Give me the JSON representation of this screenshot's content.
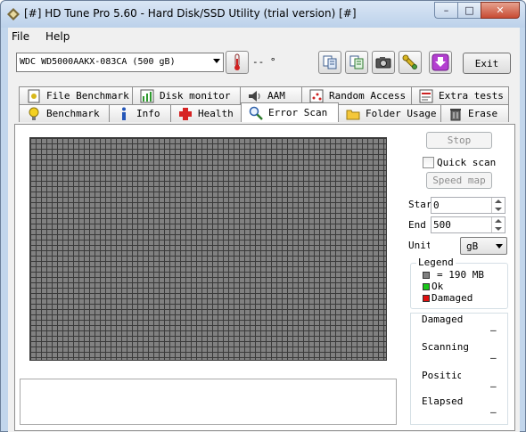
{
  "window": {
    "title": "[#] HD Tune Pro 5.60 - Hard Disk/SSD Utility (trial version) [#]",
    "minimize_glyph": "–",
    "maximize_glyph": "□",
    "close_glyph": "✕"
  },
  "menu": {
    "file_label": "File",
    "help_label": "Help"
  },
  "toolbar": {
    "drive": "WDC WD5000AAKX-083CA (500 gB)",
    "temperature": "-- °",
    "exit_label": "Exit",
    "icons": [
      "thermometer-icon",
      "copy-icon",
      "copy-all-icon",
      "camera-icon",
      "wrench-icon",
      "download-icon"
    ]
  },
  "tabs": {
    "row_top": [
      {
        "label": "File Benchmark",
        "icon": "file-benchmark-icon"
      },
      {
        "label": "Disk monitor",
        "icon": "disk-monitor-icon"
      },
      {
        "label": "AAM",
        "icon": "speaker-icon"
      },
      {
        "label": "Random Access",
        "icon": "random-access-icon"
      },
      {
        "label": "Extra tests",
        "icon": "extra-tests-icon"
      }
    ],
    "row_bottom": [
      {
        "label": "Benchmark",
        "icon": "lightbulb-icon"
      },
      {
        "label": "Info",
        "icon": "info-icon"
      },
      {
        "label": "Health",
        "icon": "health-cross-icon"
      },
      {
        "label": "Error Scan",
        "icon": "magnifier-icon"
      },
      {
        "label": "Folder Usage",
        "icon": "folder-icon"
      },
      {
        "label": "Erase",
        "icon": "trash-icon"
      }
    ],
    "active": "Error Scan"
  },
  "scan": {
    "stop_label": "Stop",
    "quick_scan_label": "Quick scan",
    "quick_scan_checked": false,
    "speed_map_label": "Speed map",
    "start_label": "Start",
    "start_value": "0",
    "end_label": "End",
    "end_value": "500",
    "unit_label": "Unit",
    "unit_value": "gB",
    "grid_color": "#818181"
  },
  "legend": {
    "title": "Legend",
    "items": [
      {
        "label": "= 190 MB",
        "color": "#808080"
      },
      {
        "label": "Ok",
        "color": "#19c619"
      },
      {
        "label": "Damaged",
        "color": "#e01010"
      }
    ]
  },
  "stats": {
    "damaged_label": "Damaged",
    "damaged_value": "–",
    "scanning_label": "Scanning",
    "scanning_value": "–",
    "position_label": "Position",
    "position_value": "–",
    "elapsed_label": "Elapsed",
    "elapsed_value": "–"
  }
}
